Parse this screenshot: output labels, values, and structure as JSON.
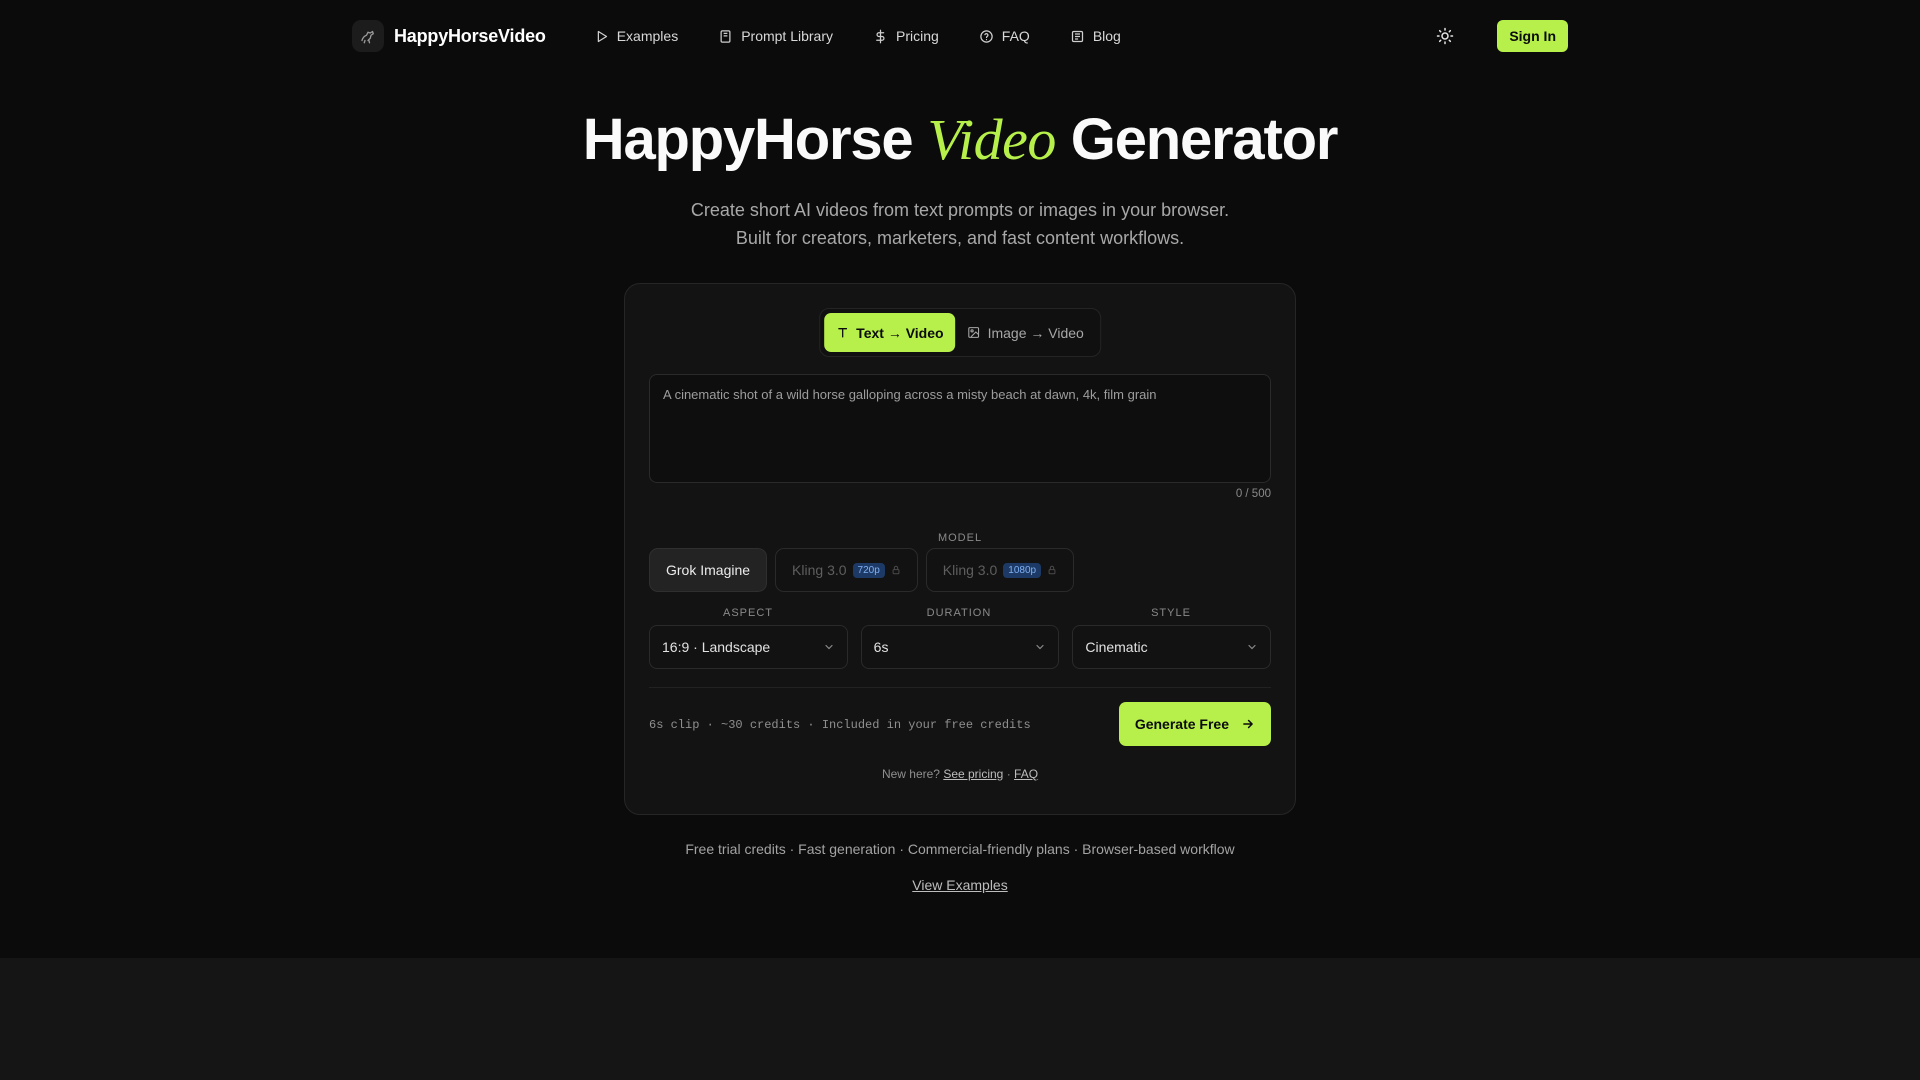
{
  "nav": {
    "brand": "HappyHorseVideo",
    "links": [
      {
        "label": "Examples",
        "icon": "play-icon"
      },
      {
        "label": "Prompt Library",
        "icon": "book-icon"
      },
      {
        "label": "Pricing",
        "icon": "dollar-icon"
      },
      {
        "label": "FAQ",
        "icon": "help-circle-icon"
      },
      {
        "label": "Blog",
        "icon": "newspaper-icon"
      }
    ],
    "theme_icon": "sun-icon",
    "sign_in": "Sign In"
  },
  "hero": {
    "title_before": "HappyHorse",
    "title_accent": "Video",
    "title_after": "Generator",
    "subtitle_line1": "Create short AI videos from text prompts or images in your browser.",
    "subtitle_line2": "Built for creators, marketers, and fast content workflows."
  },
  "generator": {
    "tabs": [
      {
        "label": "Text → Video",
        "icon": "text-icon",
        "active": true
      },
      {
        "label": "Image → Video",
        "icon": "image-icon",
        "active": false
      }
    ],
    "prompt_placeholder": "A cinematic shot of a wild horse galloping across a misty beach at dawn, 4k, film grain",
    "prompt_value": "",
    "counter": "0 / 500",
    "model_label": "MODEL",
    "models": [
      {
        "label": "Grok Imagine",
        "badge": "",
        "locked": false,
        "active": true
      },
      {
        "label": "Kling 3.0",
        "badge": "720p",
        "locked": true,
        "active": false
      },
      {
        "label": "Kling 3.0",
        "badge": "1080p",
        "locked": true,
        "active": false
      }
    ],
    "aspect_label": "ASPECT",
    "aspect_value": "16:9 · Landscape",
    "duration_label": "DURATION",
    "duration_value": "6s",
    "style_label": "STYLE",
    "style_value": "Cinematic",
    "cost_text": "6s clip · ~30 credits · Included in your free credits",
    "generate_label": "Generate Free",
    "new_here": "New here?",
    "see_pricing": "See pricing",
    "separator": "·",
    "faq_link": "FAQ"
  },
  "features": "Free trial credits · Fast generation · Commercial-friendly plans · Browser-based workflow",
  "view_examples": "View Examples",
  "colors": {
    "accent": "#b7f04a",
    "background": "#0b0b0b",
    "card": "#131313",
    "badge_bg": "#1d3a66",
    "badge_text": "#7fb0f2"
  }
}
